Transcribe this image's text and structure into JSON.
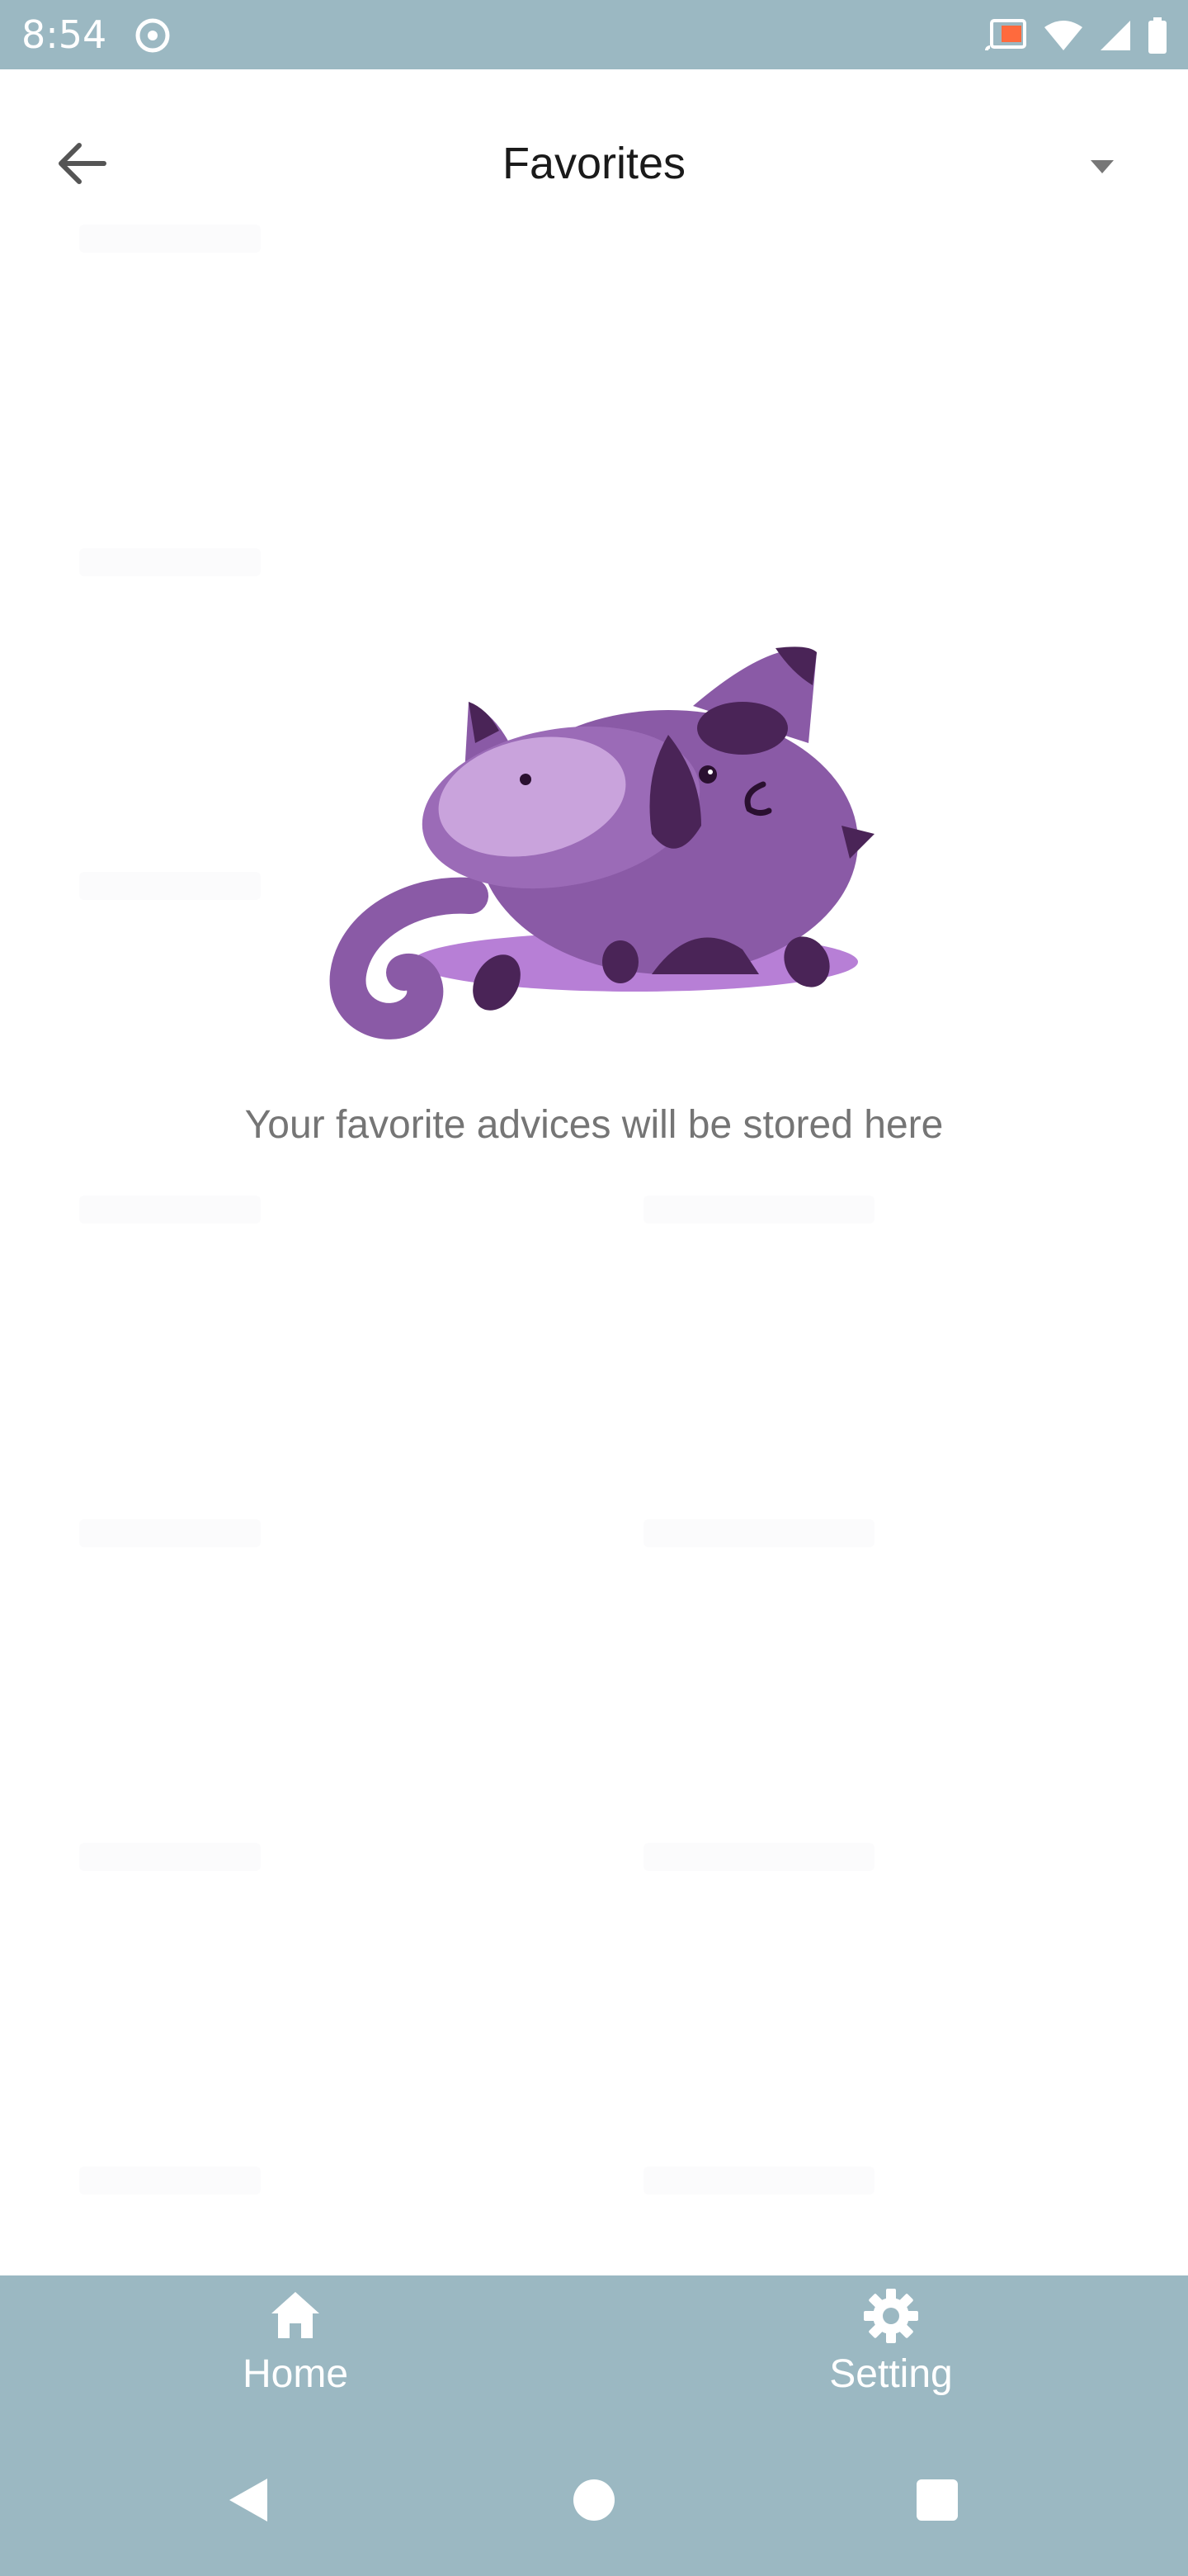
{
  "status_bar": {
    "time": "8:54",
    "icons": [
      "media-icon",
      "cast-icon",
      "wifi-icon",
      "cellular-icon",
      "battery-icon"
    ]
  },
  "header": {
    "title": "Favorites",
    "back_icon": "arrow-left-icon",
    "menu_icon": "dropdown-triangle-icon"
  },
  "empty_state": {
    "illustration": "purple-cat-illustration",
    "message": "Your favorite advices will be stored here"
  },
  "bottom_nav": {
    "items": [
      {
        "label": "Home",
        "icon": "home-icon"
      },
      {
        "label": "Setting",
        "icon": "gear-icon"
      }
    ]
  },
  "system_nav": {
    "buttons": [
      "back-triangle-icon",
      "home-circle-icon",
      "recents-square-icon"
    ]
  },
  "colors": {
    "bar_background": "#9bb8c2",
    "title_text": "#1a1a1a",
    "message_text": "#757575",
    "cat_primary": "#8a5aa6",
    "cat_light": "#c9a3dc",
    "cat_dark": "#4a2457"
  }
}
